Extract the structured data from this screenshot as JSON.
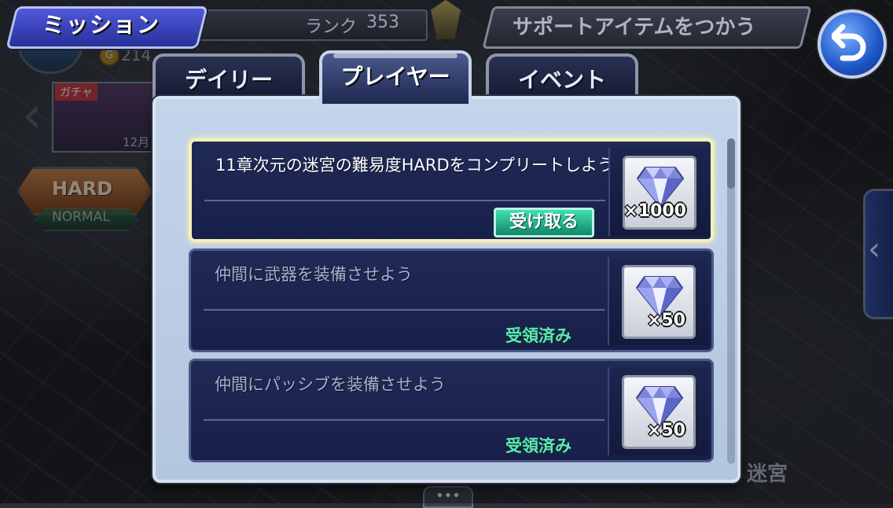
{
  "header": {
    "title": "ミッション",
    "rank_label": "ランク",
    "rank_value": "353",
    "support_label": "サポートアイテムをつかう",
    "gil": "214"
  },
  "background": {
    "gacha_label": "ガチャ",
    "gacha_date": "12月",
    "hard_label": "HARD",
    "normal_label": "NORMAL",
    "dungeon_label": "迷宮",
    "more_label": "•••"
  },
  "tabs": [
    {
      "label": "デイリー",
      "active": false
    },
    {
      "label": "プレイヤー",
      "active": true
    },
    {
      "label": "イベント",
      "active": false
    }
  ],
  "missions": [
    {
      "title": "11章次元の迷宮の難易度HARDをコンプリートしよう",
      "status": "claimable",
      "action_label": "受け取る",
      "reward_icon": "crystal-icon",
      "reward_qty": "×1000"
    },
    {
      "title": "仲間に武器を装備させよう",
      "status": "received",
      "action_label": "受領済み",
      "reward_icon": "crystal-icon",
      "reward_qty": "×50"
    },
    {
      "title": "仲間にパッシブを装備させよう",
      "status": "received",
      "action_label": "受領済み",
      "reward_icon": "crystal-icon",
      "reward_qty": "×50"
    }
  ],
  "colors": {
    "panel": "#c4d4ea",
    "mission_bg": "#1f2a55",
    "claim_button": "#3fe0b0",
    "received_text": "#5ee8b4",
    "highlight_border": "#f4f0b8"
  }
}
